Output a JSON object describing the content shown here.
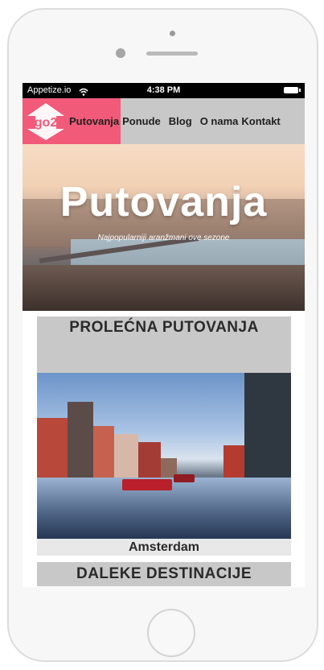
{
  "status_bar": {
    "carrier": "Appetize.io",
    "time": "4:38 PM"
  },
  "nav": {
    "logo_text": "go2",
    "items": [
      {
        "label": "Putovanja",
        "active": true
      },
      {
        "label": "Ponude",
        "active": false
      },
      {
        "label": "Blog",
        "active": false
      },
      {
        "label": "O nama",
        "active": false
      },
      {
        "label": "Kontakt",
        "active": false
      }
    ]
  },
  "hero": {
    "title": "Putovanja",
    "subtitle": "Najpopularniji aranžmani ove sezone"
  },
  "sections": {
    "spring": {
      "heading": "PROLEĆNA PUTOVANJA",
      "destination": "Amsterdam"
    },
    "far": {
      "heading": "DALEKE DESTINACIJE"
    }
  },
  "colors": {
    "brand_pink": "#f15a78",
    "nav_bg": "#c8c8c8",
    "card_bg": "#c8c8c8"
  },
  "icons": [
    "wifi-icon",
    "battery-icon",
    "logo-arrow-icon"
  ]
}
